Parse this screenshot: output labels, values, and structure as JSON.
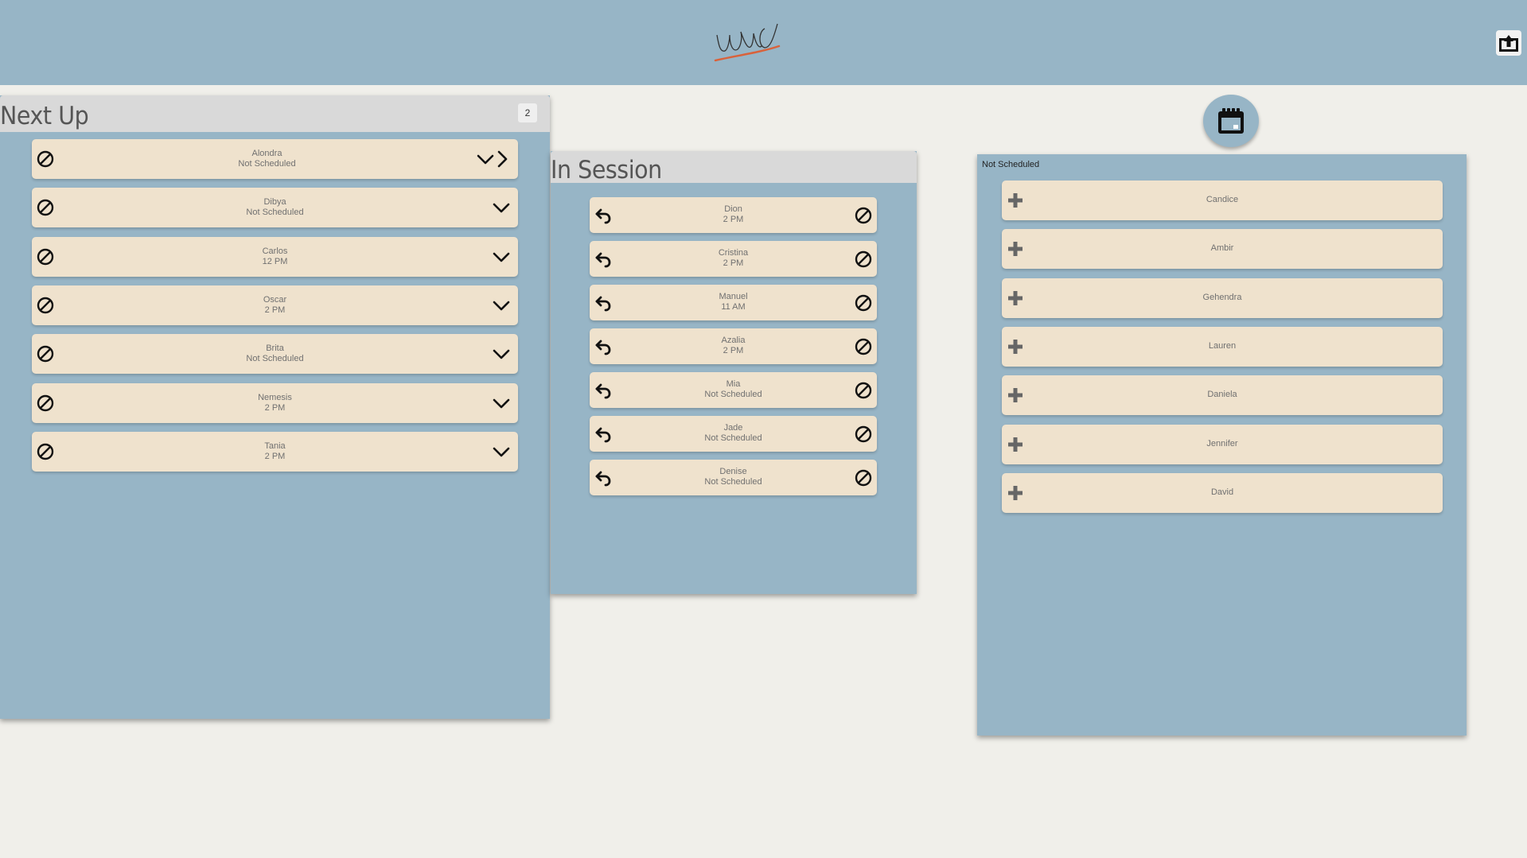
{
  "header": {
    "logo_text": "WNC"
  },
  "next_up": {
    "title": "Next Up",
    "count": "2",
    "cards": [
      {
        "name": "Alondra",
        "time": "Not Scheduled"
      },
      {
        "name": "Dibya",
        "time": "Not Scheduled"
      },
      {
        "name": "Carlos",
        "time": "12 PM"
      },
      {
        "name": "Oscar",
        "time": "2 PM"
      },
      {
        "name": "Brita",
        "time": "Not Scheduled"
      },
      {
        "name": "Nemesis",
        "time": "2 PM"
      },
      {
        "name": "Tania",
        "time": "2 PM"
      }
    ]
  },
  "in_session": {
    "title": "In Session",
    "cards": [
      {
        "name": "Dion",
        "time": "2 PM"
      },
      {
        "name": "Cristina",
        "time": "2 PM"
      },
      {
        "name": "Manuel",
        "time": "11 AM"
      },
      {
        "name": "Azalia",
        "time": "2 PM"
      },
      {
        "name": "Mia",
        "time": "Not Scheduled"
      },
      {
        "name": "Jade",
        "time": "Not Scheduled"
      },
      {
        "name": "Denise",
        "time": "Not Scheduled"
      }
    ]
  },
  "not_scheduled": {
    "title": "Not Scheduled",
    "cards": [
      {
        "name": "Candice"
      },
      {
        "name": "Ambir"
      },
      {
        "name": "Gehendra"
      },
      {
        "name": "Lauren"
      },
      {
        "name": "Daniela"
      },
      {
        "name": "Jennifer"
      },
      {
        "name": "David"
      }
    ]
  },
  "icons": {
    "cancel": "cancel-icon",
    "expand": "chevron-down-icon",
    "advance": "chevron-right-icon",
    "undo": "undo-icon",
    "add": "plus-icon",
    "calendar": "calendar-icon",
    "export": "export-icon"
  },
  "colors": {
    "topbar": "#97b5c6",
    "panel": "#97b5c6",
    "card": "#efe2cd",
    "background": "#f0efea",
    "header_strip": "#d9d9d9",
    "logo_underline": "#d9623b"
  }
}
